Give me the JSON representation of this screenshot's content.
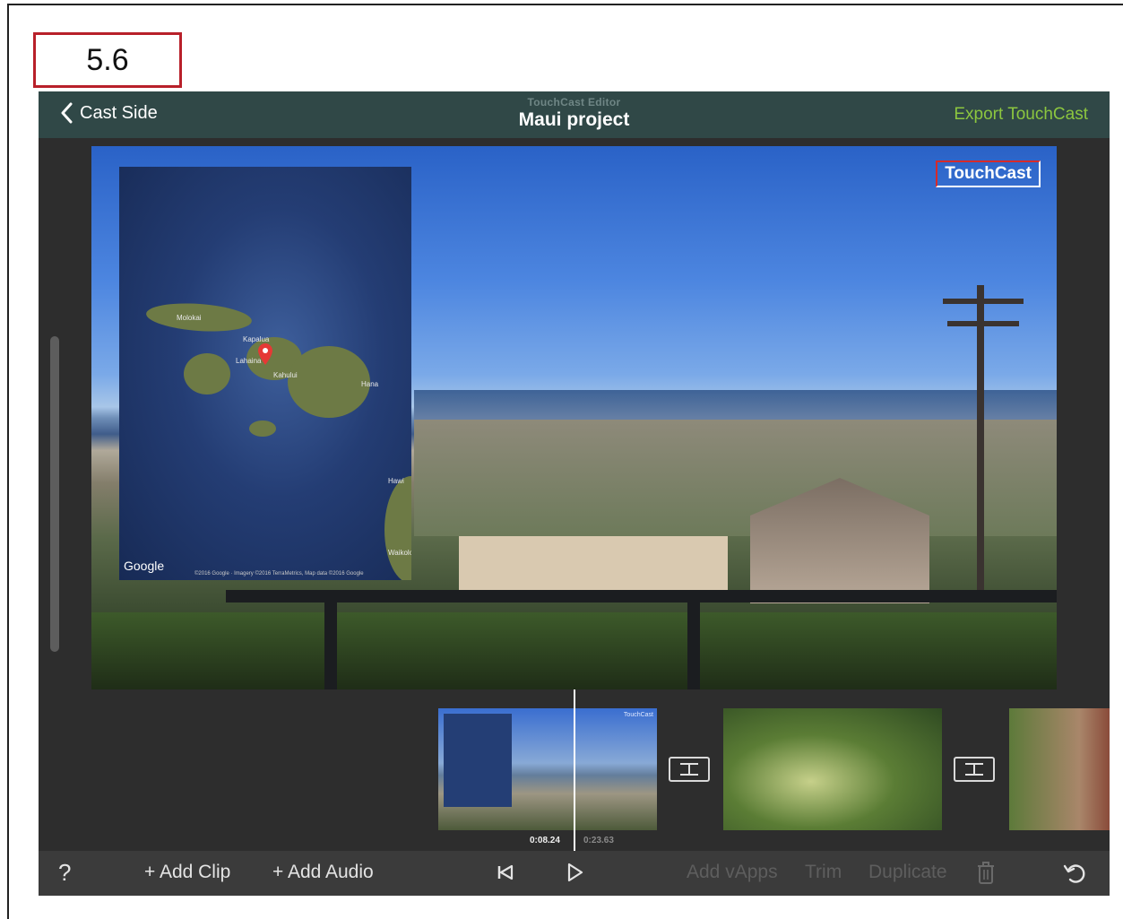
{
  "figure_label": "5.6",
  "topbar": {
    "back_label": "Cast Side",
    "subtitle": "TouchCast Editor",
    "title": "Maui project",
    "export_label": "Export TouchCast"
  },
  "preview": {
    "brand_badge": "TouchCast",
    "map": {
      "labels": [
        "Molokai",
        "Kapalua",
        "Lahaina",
        "Kahului",
        "Hana",
        "Hawi",
        "Waikoloa"
      ],
      "google_logo": "Google",
      "attribution": "©2016 Google · Imagery ©2016 TerraMetrics, Map data ©2016 Google"
    }
  },
  "timeline": {
    "current_time": "0:08.24",
    "total_time": "0:23.63",
    "clip1_badge": "TouchCast"
  },
  "toolbar": {
    "help": "?",
    "add_clip": "+ Add Clip",
    "add_audio": "+ Add Audio",
    "add_vapps": "Add vApps",
    "trim": "Trim",
    "duplicate": "Duplicate"
  },
  "colors": {
    "topbar_bg": "#304847",
    "accent_green": "#8cc63f",
    "label_border": "#b8202a",
    "workspace_bg": "#2d2d2d",
    "toolbar_bg": "#3b3b3b"
  },
  "icons": [
    "chevron-left-icon",
    "map-pin-icon",
    "transition-icon",
    "skip-back-icon",
    "play-icon",
    "trash-icon",
    "undo-icon"
  ]
}
